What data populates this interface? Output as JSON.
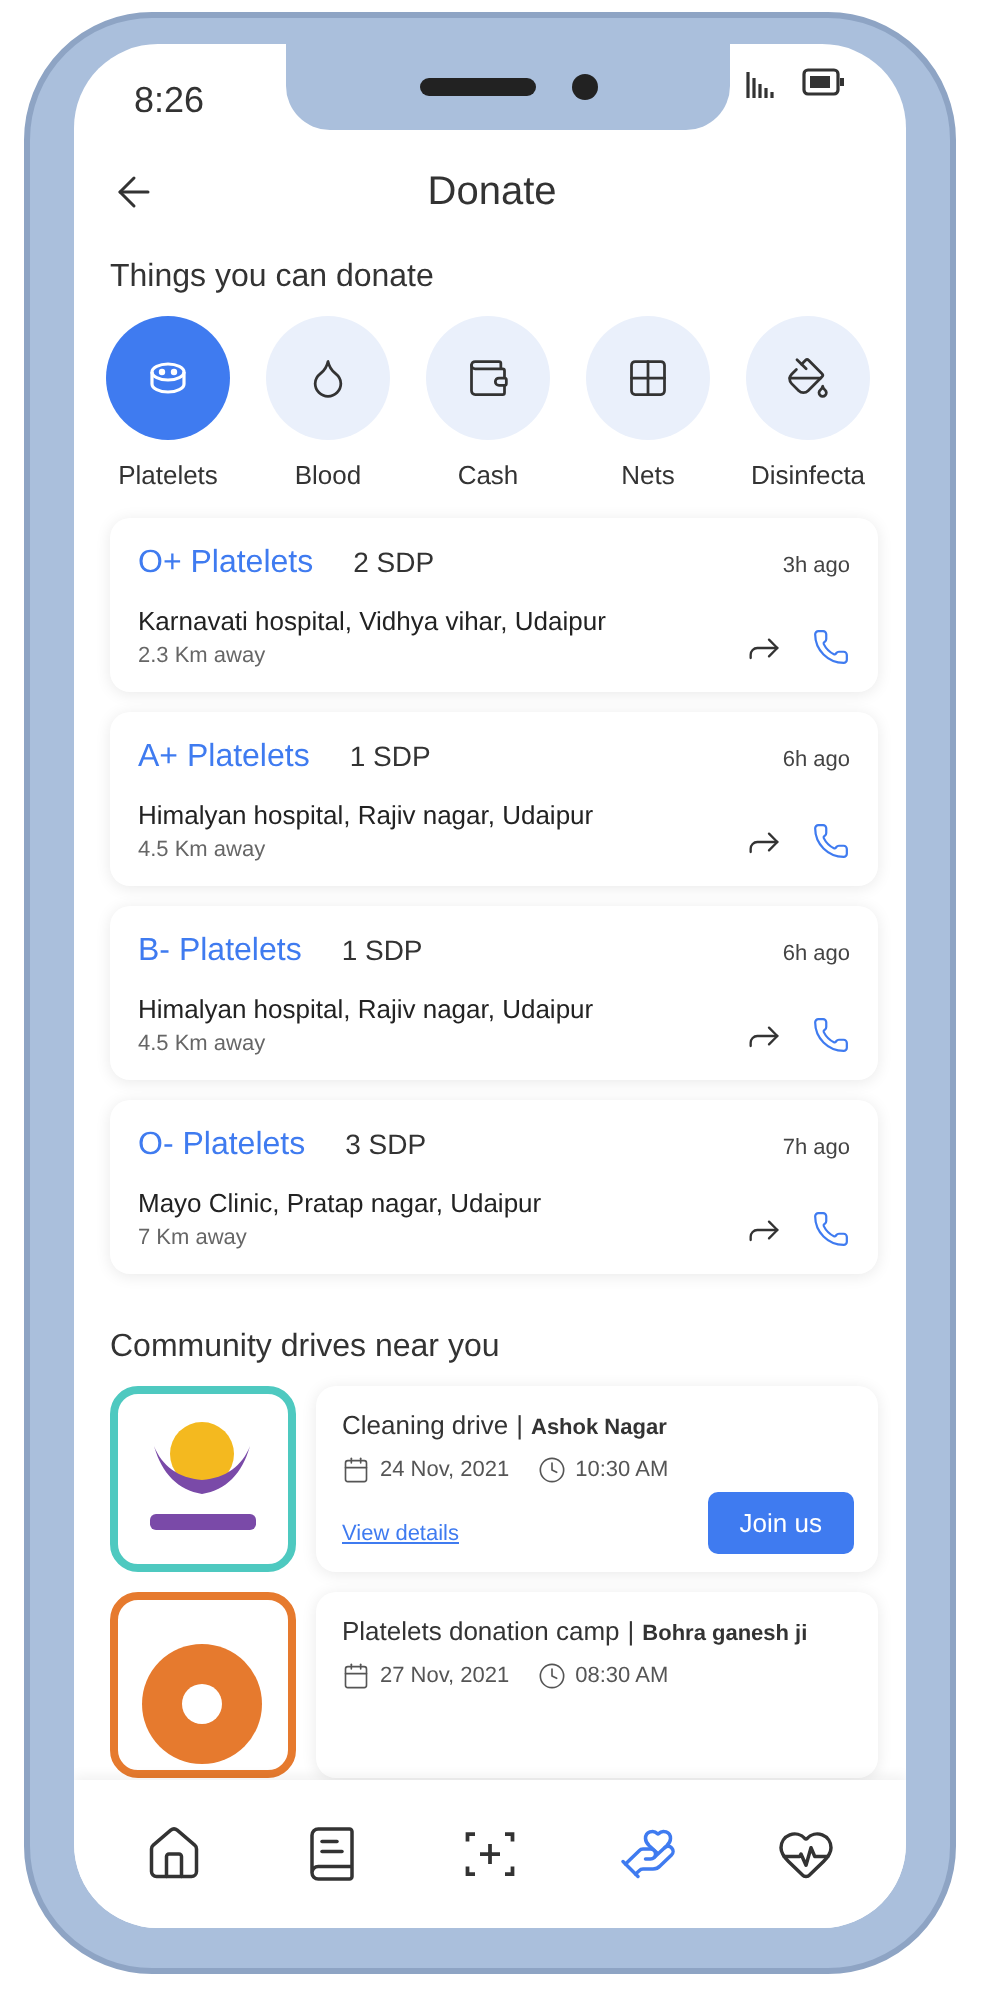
{
  "status_bar": {
    "time": "8:26"
  },
  "header": {
    "title": "Donate"
  },
  "donate_section": {
    "title": "Things you can donate",
    "items": [
      {
        "label": "Platelets",
        "kind": "platelets",
        "selected": true
      },
      {
        "label": "Blood",
        "kind": "blood",
        "selected": false
      },
      {
        "label": "Cash",
        "kind": "cash",
        "selected": false
      },
      {
        "label": "Nets",
        "kind": "nets",
        "selected": false
      },
      {
        "label": "Disinfecta",
        "kind": "disinfectant",
        "selected": false
      }
    ]
  },
  "requests": [
    {
      "title": "O+ Platelets",
      "units": "2 SDP",
      "time": "3h ago",
      "location": "Karnavati hospital, Vidhya vihar, Udaipur",
      "distance": "2.3 Km away"
    },
    {
      "title": "A+ Platelets",
      "units": "1 SDP",
      "time": "6h ago",
      "location": "Himalyan hospital, Rajiv nagar, Udaipur",
      "distance": "4.5 Km away"
    },
    {
      "title": "B- Platelets",
      "units": "1 SDP",
      "time": "6h ago",
      "location": "Himalyan hospital, Rajiv nagar, Udaipur",
      "distance": "4.5 Km away"
    },
    {
      "title": "O- Platelets",
      "units": "3 SDP",
      "time": "7h ago",
      "location": "Mayo Clinic, Pratap nagar, Udaipur",
      "distance": "7 Km away"
    }
  ],
  "drives": {
    "title": "Community drives near you",
    "items": [
      {
        "title": "Cleaning drive",
        "separator": "|",
        "area": "Ashok Nagar",
        "date": "24 Nov, 2021",
        "time": "10:30 AM",
        "link": "View details",
        "button": "Join us",
        "kind": "hands"
      },
      {
        "title": "Platelets donation camp",
        "separator": "|",
        "area": "Bohra ganesh ji",
        "date": "27 Nov, 2021",
        "time": "08:30 AM",
        "kind": "burst"
      }
    ]
  },
  "nav": [
    {
      "kind": "home",
      "selected": false
    },
    {
      "kind": "book",
      "selected": false
    },
    {
      "kind": "scan",
      "selected": false
    },
    {
      "kind": "donate",
      "selected": true
    },
    {
      "kind": "health",
      "selected": false
    }
  ]
}
